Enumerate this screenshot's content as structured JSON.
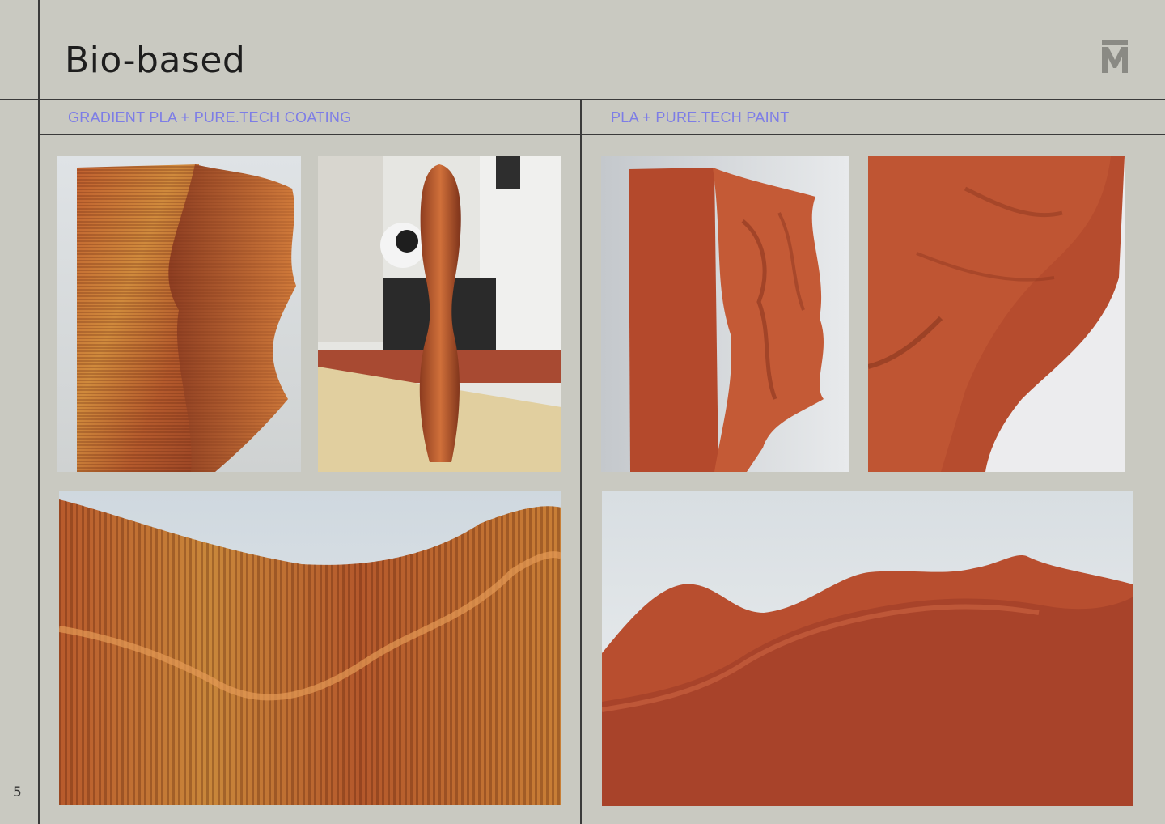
{
  "page": {
    "title": "Bio-based",
    "page_number": "5",
    "logo": "brand-m-logo"
  },
  "sections": [
    {
      "label": "GRADIENT PLA + PURE.TECH COATING"
    },
    {
      "label": "PLA + PURE.TECH PAINT"
    }
  ],
  "colors": {
    "background": "#c9c9c1",
    "rule": "#3a3a3a",
    "section_label": "#7d7de6",
    "terracotta": "#b2482c"
  }
}
